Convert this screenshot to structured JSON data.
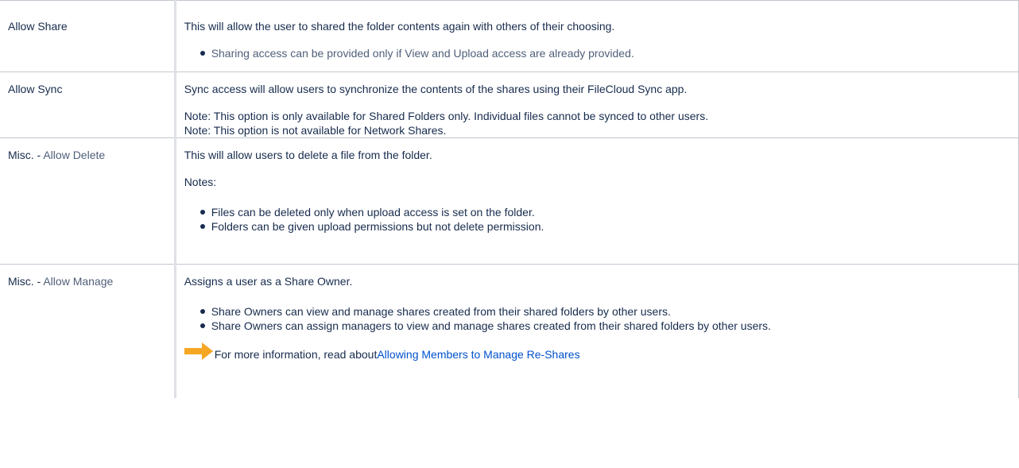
{
  "rows": [
    {
      "label": "Allow Share",
      "paragraphs": [
        "This will allow the user to shared the folder contents again with others of their choosing."
      ],
      "bullets": [
        "Sharing access can be provided only if View and Upload access are already provided."
      ]
    },
    {
      "label": "Allow Sync",
      "paragraphs": [
        "Sync access will allow users to synchronize the contents of the shares using their FileCloud Sync app.",
        "Note: This option is only available for Shared Folders only. Individual files cannot be synced to other users.",
        "Note: This option is not available for Network Shares."
      ]
    },
    {
      "label_prefix": "Misc. - ",
      "label_suffix": "Allow Delete",
      "paragraphs": [
        "This will allow users to delete a file from the folder.",
        "Notes:"
      ],
      "bullets": [
        "Files can be deleted only when upload access is set on the folder.",
        "Folders can be given upload permissions but not delete permission."
      ]
    },
    {
      "label_prefix": "Misc. - ",
      "label_suffix": "Allow Manage",
      "paragraphs": [
        "Assigns a user as a Share Owner."
      ],
      "bullets": [
        "Share Owners can view and manage shares created from their shared folders by other users.",
        "Share Owners can assign managers to view and manage shares created from their shared folders by other users."
      ],
      "info_text": "For more information, read about ",
      "info_link": "Allowing Members to Manage Re-Shares"
    }
  ],
  "colors": {
    "arrow": "#f5a623",
    "link": "#0052cc",
    "text": "#172b4d",
    "muted": "#505f79",
    "border": "#c1c7d0"
  },
  "icons": {
    "info": "right-arrow-icon"
  }
}
